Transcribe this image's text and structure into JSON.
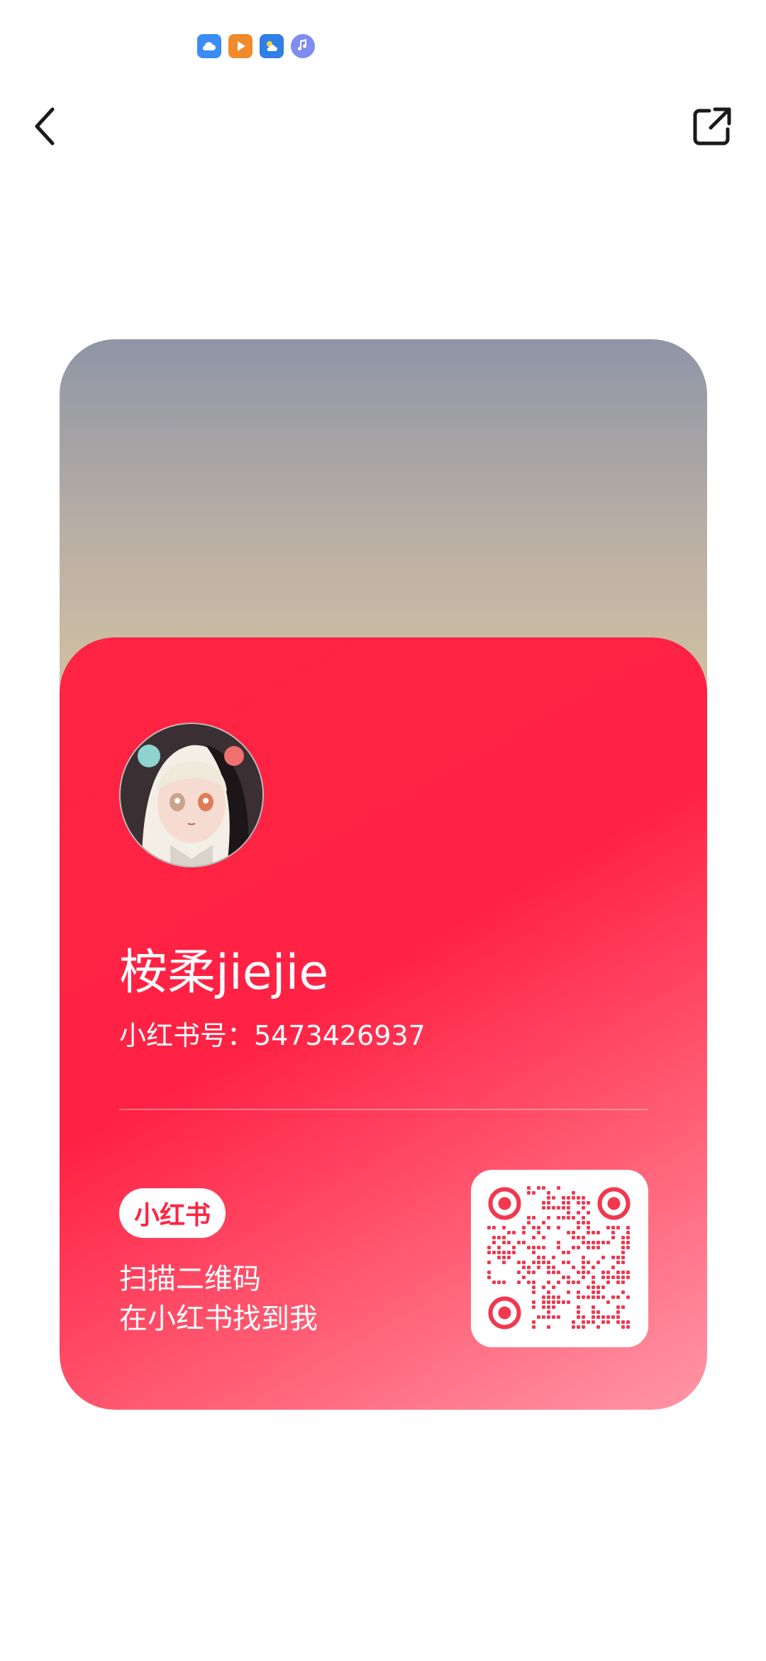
{
  "status_bar": {
    "icons": [
      "cloud-icon",
      "video-play-icon",
      "weather-icon",
      "music-icon"
    ]
  },
  "topbar": {
    "back_icon": "chevron-left-icon",
    "share_icon": "share-external-icon"
  },
  "card": {
    "nickname": "桉柔jiejie",
    "user_id": "小红书号：5473426937",
    "brand": "小红书",
    "scan_line1": "扫描二维码",
    "scan_line2": "在小红书找到我"
  },
  "colors": {
    "brand_red": "#ff2442",
    "qr_red": "#f1384f"
  }
}
